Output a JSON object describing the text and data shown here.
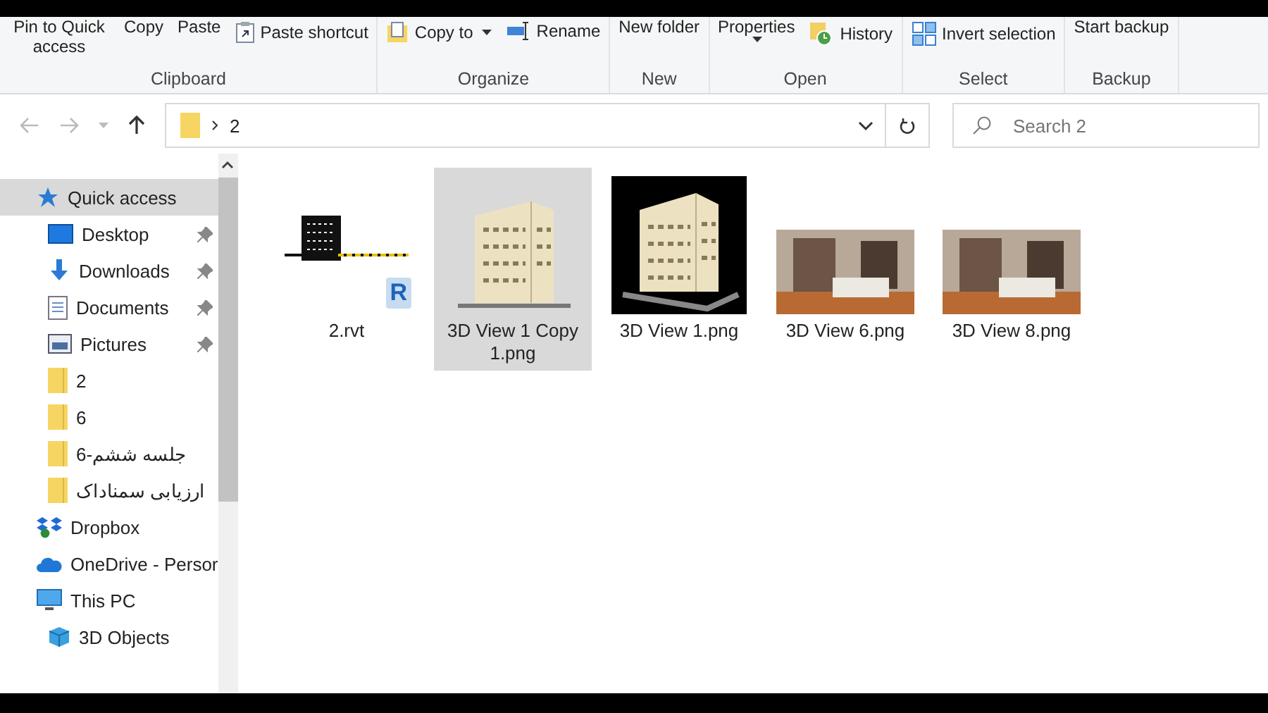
{
  "ribbon": {
    "groups": [
      {
        "label": "Clipboard",
        "commands": [
          {
            "label": "Pin to Quick access",
            "kind": "plain"
          },
          {
            "label": "Copy",
            "kind": "plain"
          },
          {
            "label": "Paste",
            "kind": "plain"
          },
          {
            "label": "Paste shortcut",
            "kind": "paste-shortcut"
          }
        ]
      },
      {
        "label": "Organize",
        "commands": [
          {
            "label": "Copy to",
            "kind": "copy-to"
          },
          {
            "label": "Rename",
            "kind": "rename"
          }
        ]
      },
      {
        "label": "New",
        "commands": [
          {
            "label": "New folder",
            "kind": "plain"
          }
        ]
      },
      {
        "label": "Open",
        "commands": [
          {
            "label": "Properties",
            "kind": "dropdown"
          },
          {
            "label": "History",
            "kind": "history"
          }
        ]
      },
      {
        "label": "Select",
        "commands": [
          {
            "label": "Invert selection",
            "kind": "invert"
          }
        ]
      },
      {
        "label": "Backup",
        "commands": [
          {
            "label": "Start backup",
            "kind": "plain"
          }
        ]
      }
    ]
  },
  "address": {
    "path": [
      "2"
    ],
    "search": {
      "placeholder": "Search 2"
    }
  },
  "sidebar": {
    "items": [
      {
        "label": "Quick access",
        "kind": "star",
        "selected": true,
        "children": [
          {
            "label": "Desktop",
            "kind": "desktop",
            "pinned": true,
            "selected": false
          },
          {
            "label": "Downloads",
            "kind": "download",
            "pinned": true,
            "selected": false
          },
          {
            "label": "Documents",
            "kind": "document",
            "pinned": true,
            "selected": false
          },
          {
            "label": "Pictures",
            "kind": "pictures",
            "pinned": true,
            "selected": false
          },
          {
            "label": "2",
            "kind": "folder",
            "pinned": false,
            "selected": false
          },
          {
            "label": "6",
            "kind": "folder",
            "pinned": false,
            "selected": false
          },
          {
            "label": "جلسه ششم-6",
            "kind": "folder",
            "pinned": false,
            "selected": false
          },
          {
            "label": "ارزیابی سمناداک",
            "kind": "folder",
            "pinned": false,
            "selected": false
          }
        ]
      },
      {
        "label": "Dropbox",
        "kind": "dropbox",
        "selected": false
      },
      {
        "label": "OneDrive - Persor",
        "kind": "cloud",
        "selected": false
      },
      {
        "label": "This PC",
        "kind": "pc",
        "selected": false,
        "children": [
          {
            "label": "3D Objects",
            "kind": "cube",
            "pinned": false,
            "selected": false
          }
        ]
      }
    ]
  },
  "files": [
    {
      "name": "2.rvt",
      "kind": "revit",
      "badge": "R",
      "selected": false
    },
    {
      "name": "3D View 1 Copy 1.png",
      "kind": "building",
      "selected": true
    },
    {
      "name": "3D View 1.png",
      "kind": "building-dark",
      "selected": false
    },
    {
      "name": "3D View 6.png",
      "kind": "interior",
      "selected": false
    },
    {
      "name": "3D View 8.png",
      "kind": "interior",
      "selected": false
    }
  ]
}
